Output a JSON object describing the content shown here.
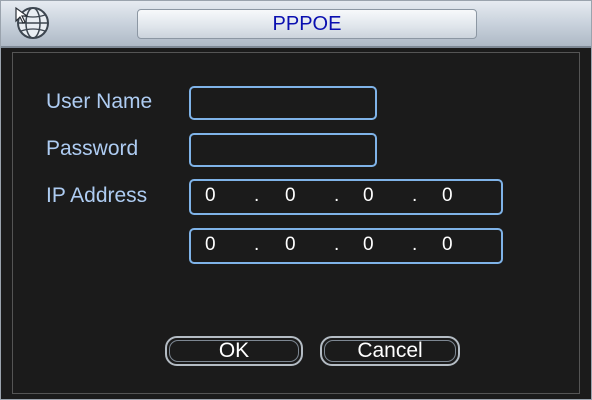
{
  "window": {
    "title": "PPPOE",
    "logo_icon": "globe-cursor-icon"
  },
  "form": {
    "username_label": "User Name",
    "username_value": "",
    "password_label": "Password",
    "password_value": "",
    "ip_label": "IP Address",
    "ip_address": [
      "0",
      "0",
      "0",
      "0"
    ],
    "ip_address_2": [
      "0",
      "0",
      "0",
      "0"
    ],
    "separator": "."
  },
  "buttons": {
    "ok": "OK",
    "cancel": "Cancel"
  },
  "colors": {
    "label": "#aeccf2",
    "field_border": "#7fb3e8",
    "title": "#0a0fb0",
    "background": "#1b1b1b"
  }
}
